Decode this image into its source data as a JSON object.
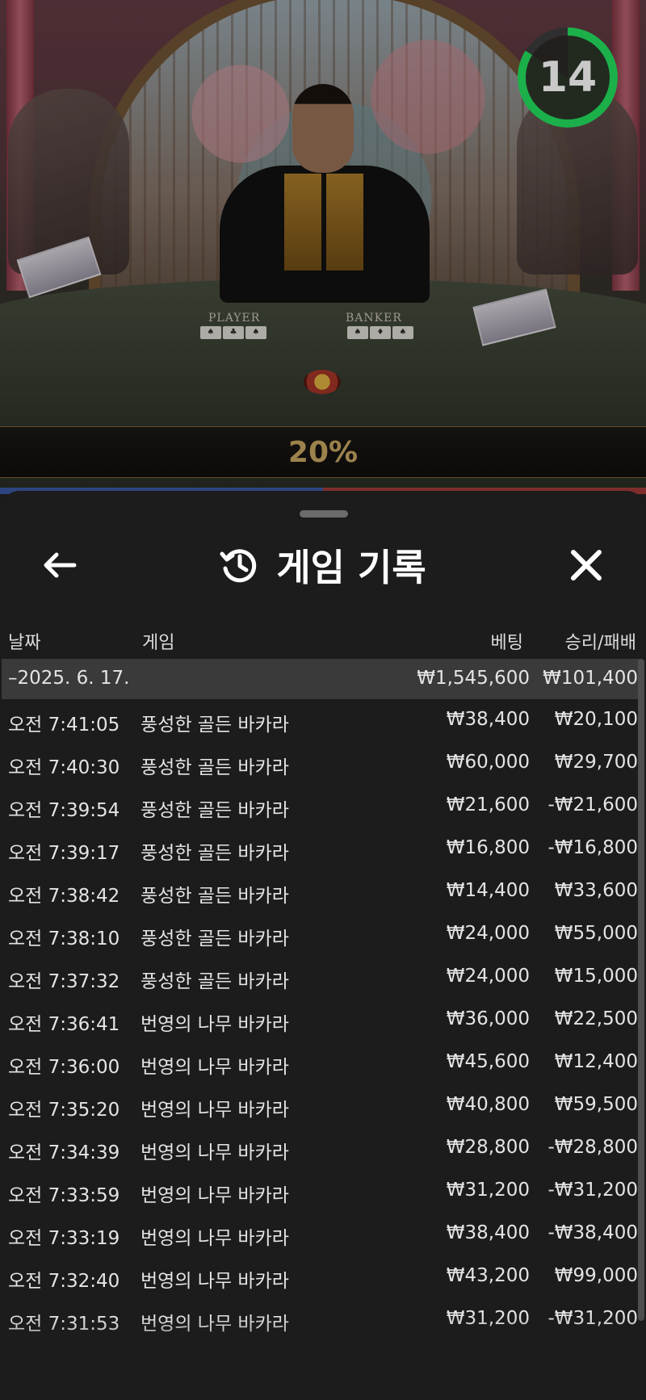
{
  "video": {
    "timer": "14",
    "timer_progress": 0.84,
    "player_label": "PLAYER",
    "banker_label": "BANKER",
    "percentage": "20%",
    "colors": {
      "timer": "#1bb04a",
      "player_bar": "#3f5fb0",
      "banker_bar": "#b0403f",
      "gold": "#d8b46a"
    }
  },
  "sheet": {
    "title": "게임 기록",
    "icons": {
      "back": "arrow-left-icon",
      "history": "history-clock-icon",
      "close": "close-icon"
    },
    "columns": {
      "date": "날짜",
      "game": "게임",
      "bet": "베팅",
      "result": "승리/패배"
    },
    "date_group": {
      "date": "–2025. 6. 17.",
      "bet": "₩1,545,600",
      "result": "₩101,400"
    },
    "rows": [
      {
        "time": "오전 7:41:05",
        "game": "풍성한 골든 바카라",
        "bet": "₩38,400",
        "result": "₩20,100"
      },
      {
        "time": "오전 7:40:30",
        "game": "풍성한 골든 바카라",
        "bet": "₩60,000",
        "result": "₩29,700"
      },
      {
        "time": "오전 7:39:54",
        "game": "풍성한 골든 바카라",
        "bet": "₩21,600",
        "result": "-₩21,600"
      },
      {
        "time": "오전 7:39:17",
        "game": "풍성한 골든 바카라",
        "bet": "₩16,800",
        "result": "-₩16,800"
      },
      {
        "time": "오전 7:38:42",
        "game": "풍성한 골든 바카라",
        "bet": "₩14,400",
        "result": "₩33,600"
      },
      {
        "time": "오전 7:38:10",
        "game": "풍성한 골든 바카라",
        "bet": "₩24,000",
        "result": "₩55,000"
      },
      {
        "time": "오전 7:37:32",
        "game": "풍성한 골든 바카라",
        "bet": "₩24,000",
        "result": "₩15,000"
      },
      {
        "time": "오전 7:36:41",
        "game": "번영의 나무 바카라",
        "bet": "₩36,000",
        "result": "₩22,500"
      },
      {
        "time": "오전 7:36:00",
        "game": "번영의 나무 바카라",
        "bet": "₩45,600",
        "result": "₩12,400"
      },
      {
        "time": "오전 7:35:20",
        "game": "번영의 나무 바카라",
        "bet": "₩40,800",
        "result": "₩59,500"
      },
      {
        "time": "오전 7:34:39",
        "game": "번영의 나무 바카라",
        "bet": "₩28,800",
        "result": "-₩28,800"
      },
      {
        "time": "오전 7:33:59",
        "game": "번영의 나무 바카라",
        "bet": "₩31,200",
        "result": "-₩31,200"
      },
      {
        "time": "오전 7:33:19",
        "game": "번영의 나무 바카라",
        "bet": "₩38,400",
        "result": "-₩38,400"
      },
      {
        "time": "오전 7:32:40",
        "game": "번영의 나무 바카라",
        "bet": "₩43,200",
        "result": "₩99,000"
      },
      {
        "time": "오전 7:31:53",
        "game": "번영의 나무 바카라",
        "bet": "₩31,200",
        "result": "-₩31,200"
      }
    ]
  }
}
